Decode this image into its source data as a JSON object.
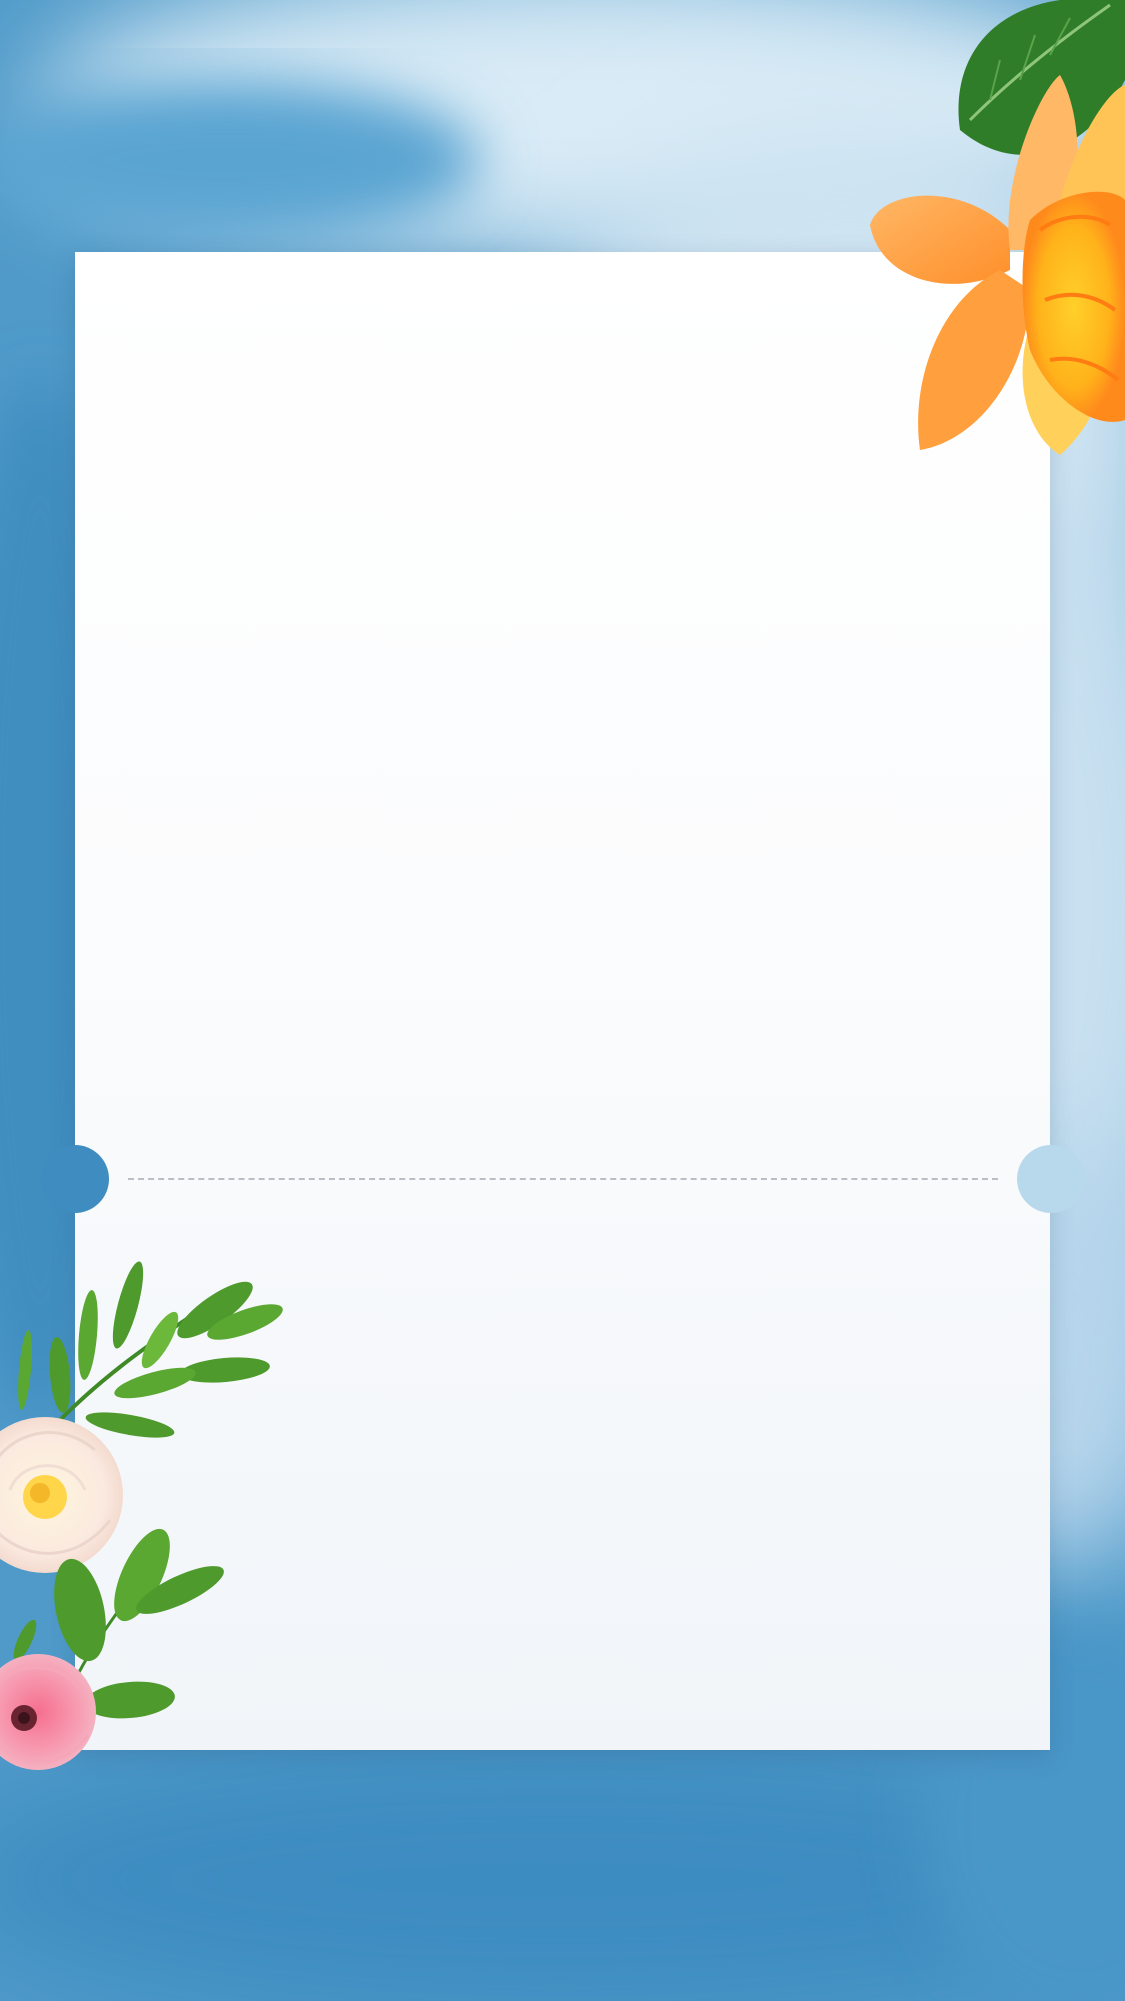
{
  "background": {
    "style": "blue-watercolor",
    "colors": {
      "base": "#4f9ac9",
      "light": "#d6e9f5",
      "deep": "#3a86bb"
    }
  },
  "card": {
    "style": "blank-ticket",
    "color": "#ffffff",
    "perforation_color": "#b9bec4"
  },
  "decorations": {
    "top_right": [
      "leaf-icon",
      "daffodil-icon"
    ],
    "bottom_left": [
      "fern-sprig-icon",
      "white-rose-icon",
      "pink-ranunculus-icon"
    ]
  }
}
